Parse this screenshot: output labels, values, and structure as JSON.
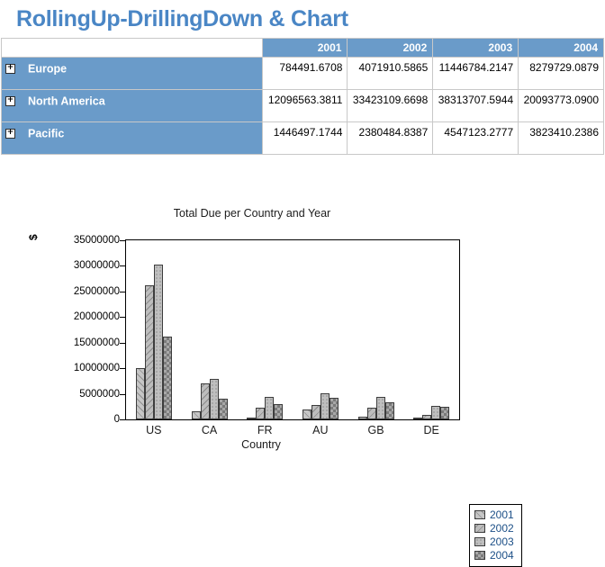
{
  "page": {
    "title": "RollingUp-DrillingDown & Chart",
    "title_color": "#4a86c5"
  },
  "pivot_table": {
    "corner_label": "",
    "expand_icon": "+",
    "columns": [
      "2001",
      "2002",
      "2003",
      "2004"
    ],
    "rows": [
      {
        "label": "Europe",
        "values": [
          "784491.6708",
          "4071910.5865",
          "11446784.2147",
          "8279729.0879"
        ]
      },
      {
        "label": "North America",
        "values": [
          "12096563.3811",
          "33423109.6698",
          "38313707.5944",
          "20093773.0900"
        ]
      },
      {
        "label": "Pacific",
        "values": [
          "1446497.1744",
          "2380484.8387",
          "4547123.2777",
          "3823410.2386"
        ]
      }
    ],
    "header_color": "#6a9bc9"
  },
  "chart_data": {
    "type": "bar",
    "title": "Total Due per Country and Year",
    "xlabel": "Country",
    "ylabel": "$",
    "categories": [
      "US",
      "CA",
      "FR",
      "AU",
      "GB",
      "DE"
    ],
    "series": [
      {
        "name": "2001",
        "values": [
          10000000,
          1500000,
          300000,
          2000000,
          500000,
          300000
        ]
      },
      {
        "name": "2002",
        "values": [
          26200000,
          7000000,
          2200000,
          2800000,
          2200000,
          900000
        ]
      },
      {
        "name": "2003",
        "values": [
          30200000,
          8000000,
          4400000,
          5100000,
          4400000,
          2600000
        ]
      },
      {
        "name": "2004",
        "values": [
          16100000,
          4000000,
          3000000,
          4300000,
          3400000,
          2500000
        ]
      }
    ],
    "ylim": [
      0,
      35000000
    ],
    "ytick_labels": [
      "35000000",
      "30000000",
      "25000000",
      "20000000",
      "15000000",
      "10000000",
      "5000000",
      "0"
    ],
    "ytick_values": [
      35000000,
      30000000,
      25000000,
      20000000,
      15000000,
      10000000,
      5000000,
      0
    ],
    "legend_position": "right",
    "grid": false
  }
}
